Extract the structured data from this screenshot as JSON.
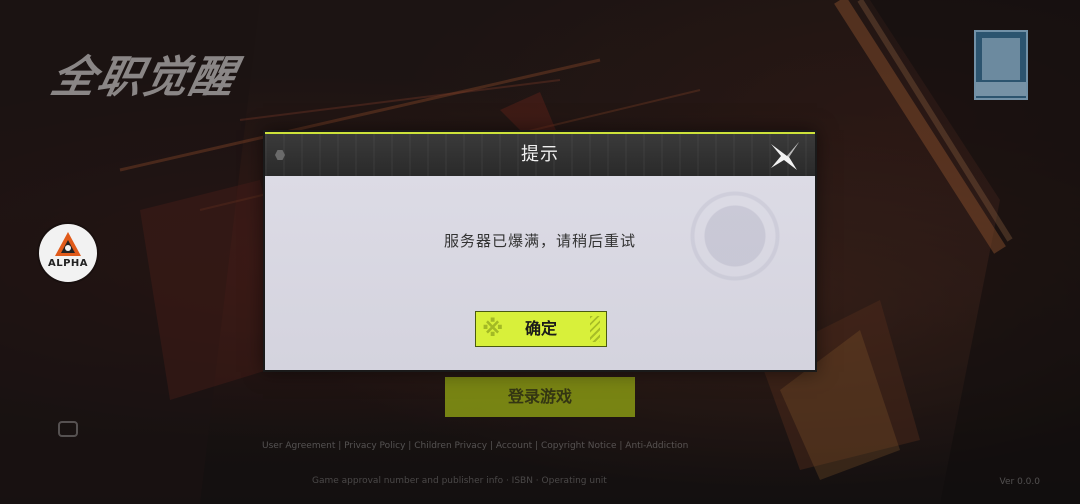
{
  "game": {
    "logo_text": "全职觉醒",
    "start_button_label": "登录游戏",
    "alpha_badge_label": "ALPHA",
    "footer_links": "User Agreement  |  Privacy Policy  |  Children Privacy  |  Account  |  Copyright Notice  |  Anti-Addiction",
    "footer_line2": "Game approval number and publisher info  ·  ISBN  ·  Operating unit",
    "version": "Ver 0.0.0"
  },
  "dialog": {
    "title": "提示",
    "message": "服务器已爆满，请稍后重试",
    "confirm_label": "确定"
  },
  "colors": {
    "accent_yellow_green": "#d8f03a",
    "header_dark": "#2e2e2e",
    "body_light": "#d9d8e2"
  },
  "icons": {
    "close": "close-x-icon",
    "chat": "chat-icon",
    "alpha": "alpha-logo-icon",
    "age_rating": "age-rating-icon"
  }
}
